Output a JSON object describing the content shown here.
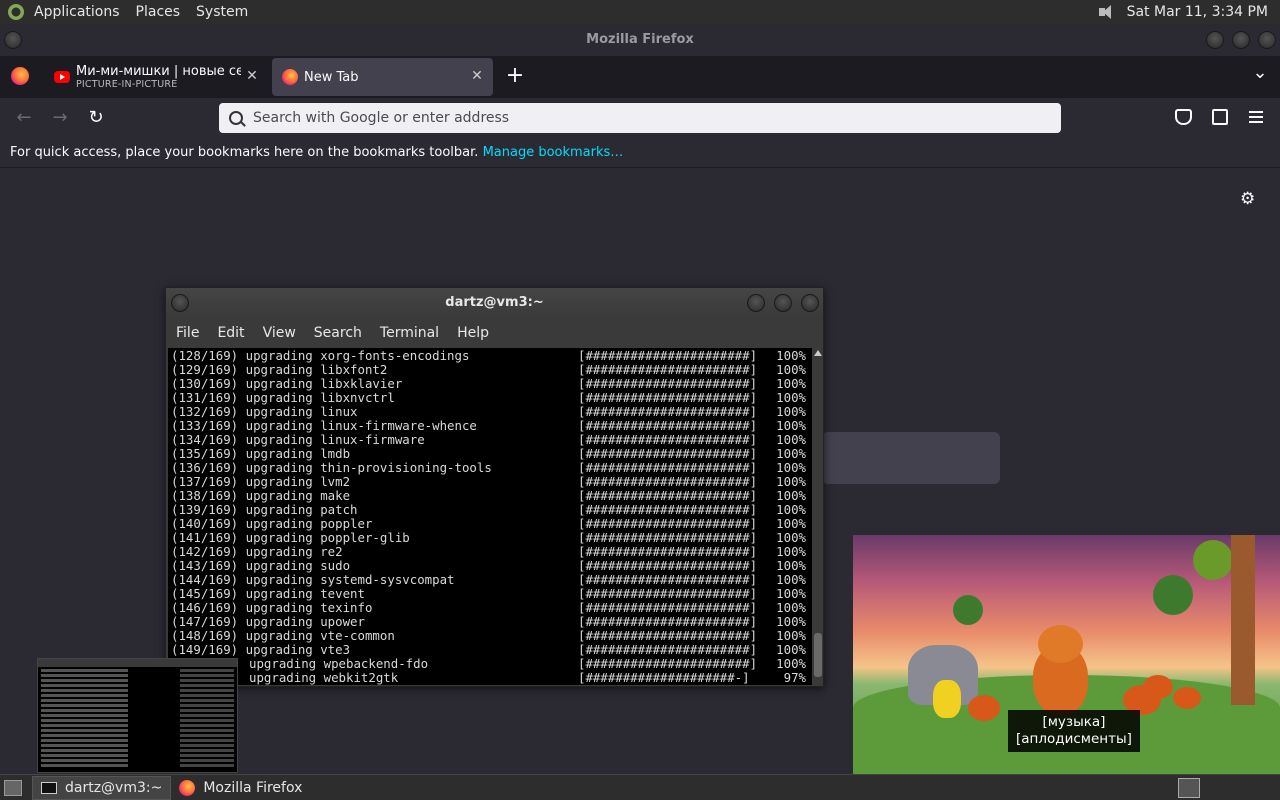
{
  "top_panel": {
    "menus": [
      "Applications",
      "Places",
      "System"
    ],
    "clock": "Sat Mar 11,  3:34 PM"
  },
  "firefox": {
    "window_title": "Mozilla Firefox",
    "tabs": [
      {
        "title": "Ми-ми-мишки | новые серии",
        "subtitle": "PICTURE-IN-PICTURE"
      },
      {
        "title": "New Tab"
      }
    ],
    "close_glyph": "✕",
    "new_tab_glyph": "+",
    "list_tabs_glyph": "⌄",
    "nav": {
      "back": "←",
      "forward": "→",
      "reload": "↻"
    },
    "url_placeholder": "Search with Google or enter address",
    "bookmarks_bar": {
      "text": "For quick access, place your bookmarks here on the bookmarks toolbar. ",
      "link": "Manage bookmarks…"
    },
    "settings_glyph": "⚙"
  },
  "terminal": {
    "title": "dartz@vm3:~",
    "menu": [
      "File",
      "Edit",
      "View",
      "Search",
      "Terminal",
      "Help"
    ],
    "lines": [
      {
        "num": "(128/169)",
        "pkg": "xorg-fonts-encodings",
        "bar": "[######################]",
        "pct": "100%"
      },
      {
        "num": "(129/169)",
        "pkg": "libxfont2",
        "bar": "[######################]",
        "pct": "100%"
      },
      {
        "num": "(130/169)",
        "pkg": "libxklavier",
        "bar": "[######################]",
        "pct": "100%"
      },
      {
        "num": "(131/169)",
        "pkg": "libxnvctrl",
        "bar": "[######################]",
        "pct": "100%"
      },
      {
        "num": "(132/169)",
        "pkg": "linux",
        "bar": "[######################]",
        "pct": "100%"
      },
      {
        "num": "(133/169)",
        "pkg": "linux-firmware-whence",
        "bar": "[######################]",
        "pct": "100%"
      },
      {
        "num": "(134/169)",
        "pkg": "linux-firmware",
        "bar": "[######################]",
        "pct": "100%"
      },
      {
        "num": "(135/169)",
        "pkg": "lmdb",
        "bar": "[######################]",
        "pct": "100%"
      },
      {
        "num": "(136/169)",
        "pkg": "thin-provisioning-tools",
        "bar": "[######################]",
        "pct": "100%"
      },
      {
        "num": "(137/169)",
        "pkg": "lvm2",
        "bar": "[######################]",
        "pct": "100%"
      },
      {
        "num": "(138/169)",
        "pkg": "make",
        "bar": "[######################]",
        "pct": "100%"
      },
      {
        "num": "(139/169)",
        "pkg": "patch",
        "bar": "[######################]",
        "pct": "100%"
      },
      {
        "num": "(140/169)",
        "pkg": "poppler",
        "bar": "[######################]",
        "pct": "100%"
      },
      {
        "num": "(141/169)",
        "pkg": "poppler-glib",
        "bar": "[######################]",
        "pct": "100%"
      },
      {
        "num": "(142/169)",
        "pkg": "re2",
        "bar": "[######################]",
        "pct": "100%"
      },
      {
        "num": "(143/169)",
        "pkg": "sudo",
        "bar": "[######################]",
        "pct": "100%"
      },
      {
        "num": "(144/169)",
        "pkg": "systemd-sysvcompat",
        "bar": "[######################]",
        "pct": "100%"
      },
      {
        "num": "(145/169)",
        "pkg": "tevent",
        "bar": "[######################]",
        "pct": "100%"
      },
      {
        "num": "(146/169)",
        "pkg": "texinfo",
        "bar": "[######################]",
        "pct": "100%"
      },
      {
        "num": "(147/169)",
        "pkg": "upower",
        "bar": "[######################]",
        "pct": "100%"
      },
      {
        "num": "(148/169)",
        "pkg": "vte-common",
        "bar": "[######################]",
        "pct": "100%"
      },
      {
        "num": "(149/169)",
        "pkg": "vte3",
        "bar": "[######################]",
        "pct": "100%"
      },
      {
        "num": "",
        "pkg": "wpebackend-fdo",
        "bar": "[######################]",
        "pct": "100%"
      },
      {
        "num": "",
        "pkg": "webkit2gtk",
        "bar": "[####################-]",
        "pct": "97%"
      }
    ],
    "verb": "upgrading"
  },
  "pip_video": {
    "subtitle_line1": "[музыка]",
    "subtitle_line2": "[аплодисменты]"
  },
  "taskbar": {
    "items": [
      {
        "label": "dartz@vm3:~"
      },
      {
        "label": "Mozilla Firefox"
      }
    ]
  },
  "colors": {
    "accent_link": "#00ddff",
    "firefox_bg": "#2b2a33",
    "terminal_bg": "#000000"
  }
}
